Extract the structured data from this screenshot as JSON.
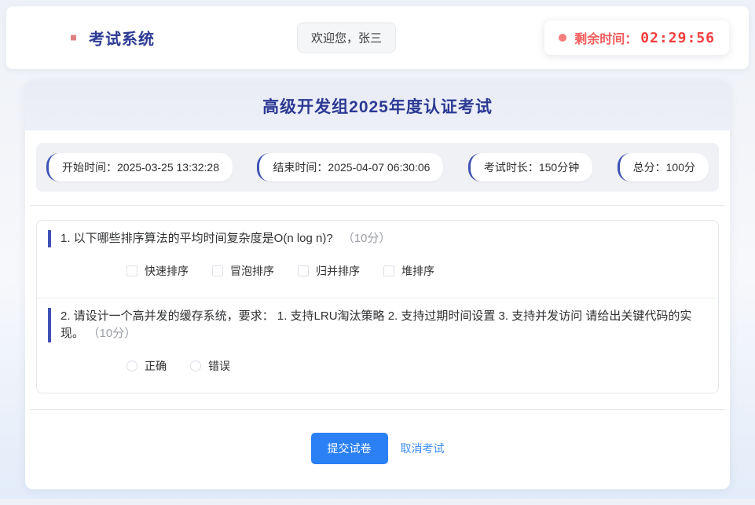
{
  "header": {
    "app_title": "考试系统",
    "welcome_text": "欢迎您，张三",
    "timer": {
      "label": "剩余时间：",
      "value": "02:29:56"
    }
  },
  "exam": {
    "title": "高级开发组2025年度认证考试",
    "meta": [
      {
        "text": "开始时间：2025-03-25 13:32:28"
      },
      {
        "text": "结束时间：2025-04-07 06:30:06"
      },
      {
        "text": "考试时长：150分钟"
      },
      {
        "text": "总分：100分"
      }
    ]
  },
  "questions": [
    {
      "type": "checkbox",
      "text": "1. 以下哪些排序算法的平均时间复杂度是O(n log n)?",
      "score": "（10分）",
      "options": [
        "快速排序",
        "冒泡排序",
        "归并排序",
        "堆排序"
      ]
    },
    {
      "type": "radio",
      "text": "2. 请设计一个高并发的缓存系统，要求： 1. 支持LRU淘汰策略 2. 支持过期时间设置 3. 支持并发访问 请给出关键代码的实现。",
      "score": "（10分）",
      "options": [
        "正确",
        "错误"
      ]
    }
  ],
  "footer": {
    "submit_label": "提交试卷",
    "cancel_label": "取消考试"
  },
  "colors": {
    "brand_blue": "#2c3a94",
    "accent_indigo": "#3f51b5",
    "timer_red": "#f43d3d",
    "button_blue": "#2b80f5",
    "link_blue": "#3d8df5",
    "title_band_bg": "#e9ebf6",
    "meta_bar_bg": "#f0f1f4"
  }
}
